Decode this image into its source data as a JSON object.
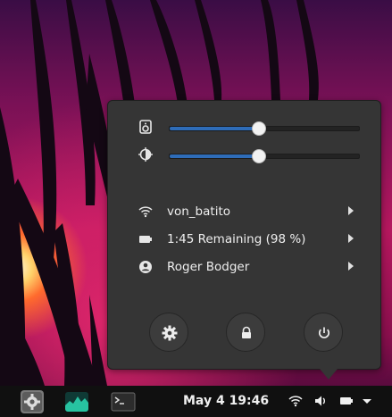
{
  "menu": {
    "volume": {
      "level": 0.47
    },
    "brightness": {
      "level": 0.47
    },
    "items": [
      {
        "icon": "wifi-icon",
        "label": "von_batito"
      },
      {
        "icon": "battery-icon",
        "label": "1:45 Remaining (98 %)"
      },
      {
        "icon": "user-icon",
        "label": "Roger Bodger"
      }
    ],
    "buttons": [
      {
        "icon": "settings-icon"
      },
      {
        "icon": "lock-icon"
      },
      {
        "icon": "power-icon"
      }
    ]
  },
  "taskbar": {
    "apps": [
      {
        "icon": "system-settings-icon"
      },
      {
        "icon": "system-monitor-icon"
      },
      {
        "icon": "terminal-icon"
      }
    ],
    "clock": "May 4  19:46",
    "tray": [
      "wifi-icon",
      "volume-icon",
      "battery-icon",
      "menu-arrow-icon"
    ]
  },
  "colors": {
    "menu_bg": "#353535",
    "accent": "#2e6cb8",
    "taskbar_bg": "#101010"
  }
}
